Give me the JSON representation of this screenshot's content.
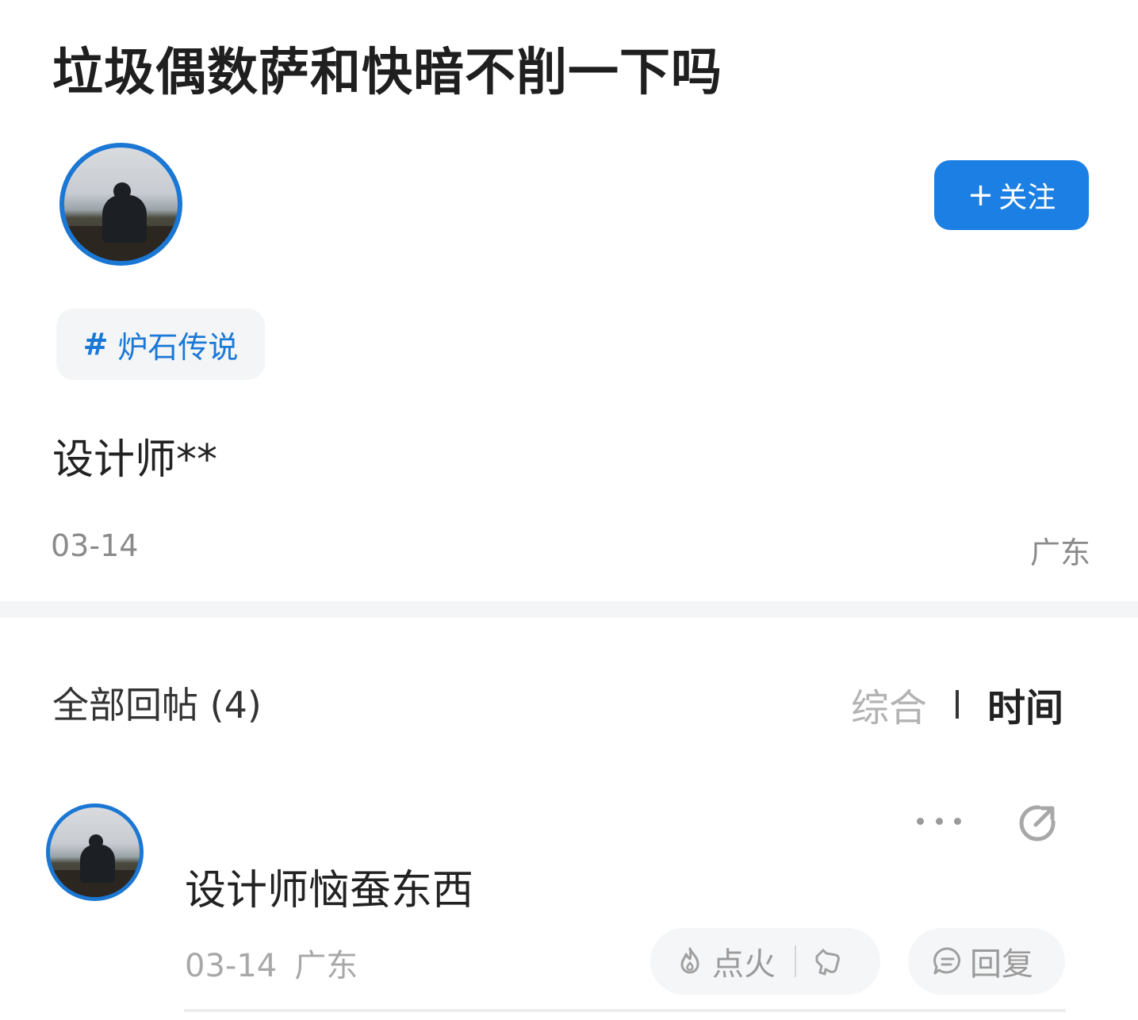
{
  "post": {
    "title": "垃圾偶数萨和快暗不削一下吗",
    "follow_plus": "+",
    "follow_label": "关注",
    "topic_hash": "#",
    "topic_name": "炉石传说",
    "body": "设计师**",
    "date": "03-14",
    "location": "广东"
  },
  "replies": {
    "header": "全部回帖 (4)",
    "sort_options": [
      "综合",
      "时间"
    ],
    "active_sort": "时间",
    "items": [
      {
        "text": "设计师恼蚕东西",
        "date": "03-14",
        "location": "广东",
        "like_label": "点火",
        "reply_label": "回复"
      }
    ]
  },
  "icons": {
    "avatar_main": "user-avatar-photo",
    "avatar_reply": "user-avatar-photo",
    "more": "more-horizontal-icon",
    "share": "share-icon",
    "fire": "fire-icon",
    "dislike": "thumb-down-icon",
    "comment": "comment-icon"
  },
  "colors": {
    "accent": "#1b7fe3",
    "avatar_ring": "#1b77d4",
    "muted_text": "#8a8a8a",
    "divider": "#f4f5f6"
  }
}
